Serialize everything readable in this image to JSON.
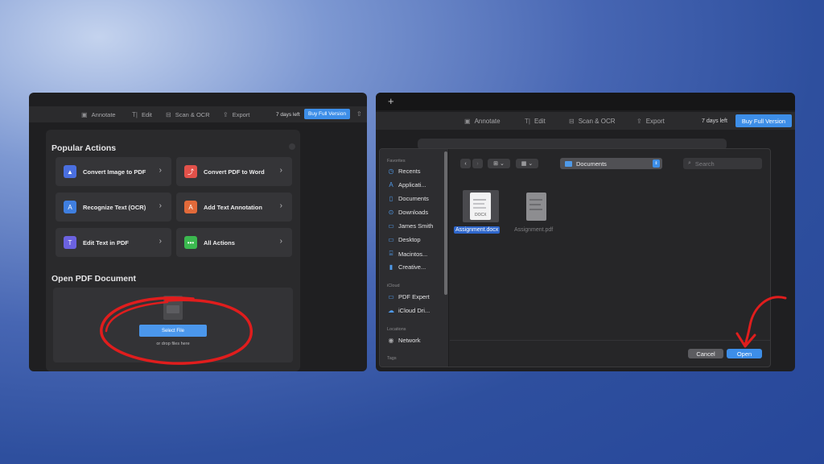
{
  "left_window": {
    "toolbar": {
      "items": [
        {
          "label": "Annotate",
          "icon": "annotate-icon"
        },
        {
          "label": "Edit",
          "icon": "text-cursor-icon"
        },
        {
          "label": "Scan & OCR",
          "icon": "scan-icon"
        },
        {
          "label": "Export",
          "icon": "export-icon"
        }
      ],
      "trial": "7 days left",
      "buy": "Buy Full Version"
    },
    "popular": {
      "title": "Popular Actions",
      "actions": [
        {
          "label": "Convert Image to PDF",
          "icon": "image-to-pdf-icon",
          "color": "#4a6fe0"
        },
        {
          "label": "Convert PDF to Word",
          "icon": "pdf-to-word-icon",
          "color": "#e2514a"
        },
        {
          "label": "Recognize Text (OCR)",
          "icon": "ocr-icon",
          "color": "#3f7fe0"
        },
        {
          "label": "Add Text Annotation",
          "icon": "text-annotation-icon",
          "color": "#e26a3a"
        },
        {
          "label": "Edit Text in PDF",
          "icon": "edit-text-icon",
          "color": "#6b62e0"
        },
        {
          "label": "All Actions",
          "icon": "more-icon",
          "color": "#3bb84f"
        }
      ]
    },
    "open": {
      "title": "Open PDF Document",
      "select_label": "Select File",
      "drop_label": "or drop files here"
    }
  },
  "right_window": {
    "toolbar": {
      "items": [
        {
          "label": "Annotate",
          "icon": "annotate-icon"
        },
        {
          "label": "Edit",
          "icon": "text-cursor-icon"
        },
        {
          "label": "Scan & OCR",
          "icon": "scan-icon"
        },
        {
          "label": "Export",
          "icon": "export-icon"
        }
      ],
      "trial": "7 days left",
      "buy": "Buy Full Version"
    },
    "dialog": {
      "sidebar": {
        "favorites_label": "Favorites",
        "favorites": [
          "Recents",
          "Applicati...",
          "Documents",
          "Downloads",
          "James Smith",
          "Desktop",
          "Macintos...",
          "Creative..."
        ],
        "icloud_label": "iCloud",
        "icloud": [
          "PDF Expert",
          "iCloud Dri..."
        ],
        "locations_label": "Locations",
        "locations": [
          "Network"
        ],
        "tags_label": "Tags"
      },
      "path": "Documents",
      "search_placeholder": "Search",
      "files": [
        {
          "name": "Assignment.docx",
          "badge": "DOCX",
          "selected": true
        },
        {
          "name": "Assignment.pdf",
          "selected": false
        }
      ],
      "cancel": "Cancel",
      "open": "Open"
    }
  },
  "colors": {
    "accent": "#3d8ee8",
    "annotation_red": "#e01d1d"
  }
}
